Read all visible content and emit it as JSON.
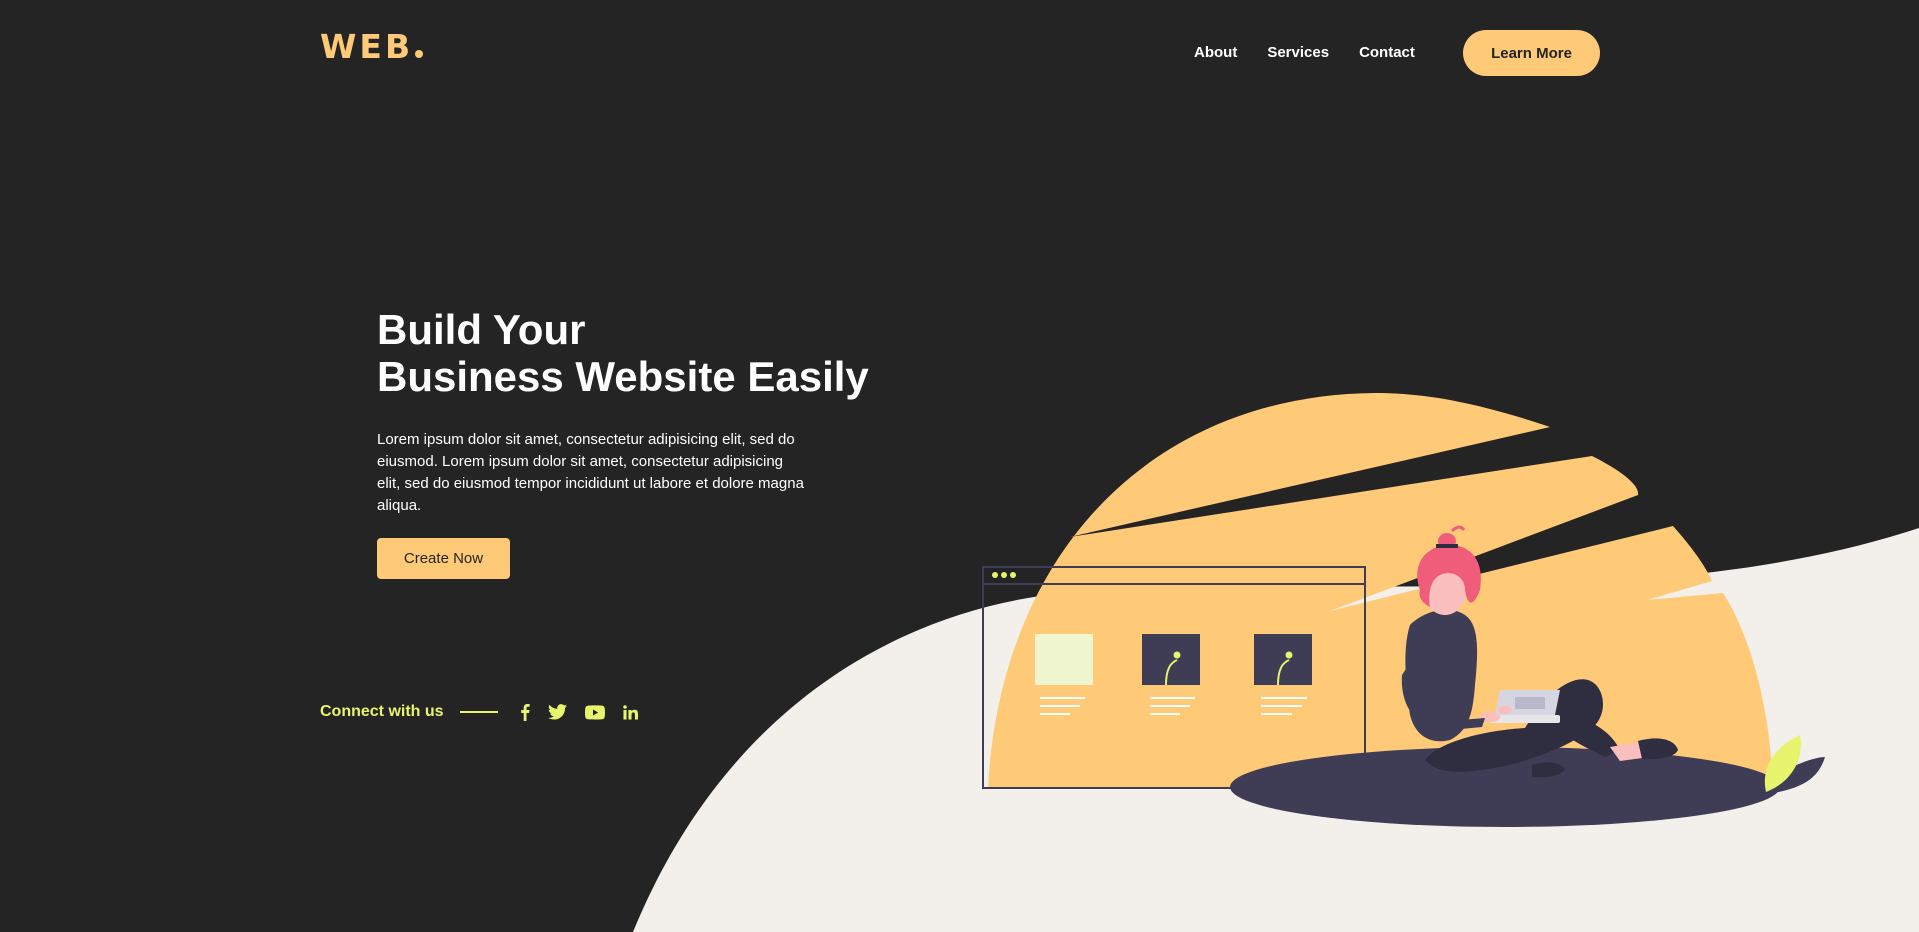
{
  "brand": {
    "logo_text": "WEB"
  },
  "nav": {
    "items": [
      {
        "label": "About"
      },
      {
        "label": "Services"
      },
      {
        "label": "Contact"
      }
    ],
    "cta_label": "Learn More"
  },
  "hero": {
    "title_line1": "Build Your",
    "title_line2": "Business Website Easily",
    "description": "Lorem ipsum dolor sit amet, consectetur adipisicing elit, sed do eiusmod. Lorem ipsum dolor sit amet, consectetur adipisicing elit, sed do eiusmod tempor incididunt ut labore et dolore magna aliqua.",
    "button_label": "Create Now"
  },
  "connect": {
    "label": "Connect with us",
    "socials": [
      {
        "icon": "facebook-icon"
      },
      {
        "icon": "twitter-icon"
      },
      {
        "icon": "youtube-icon"
      },
      {
        "icon": "linkedin-icon"
      }
    ]
  },
  "colors": {
    "background": "#242424",
    "accent": "#ffca78",
    "lime": "#e6f56d",
    "light_bg": "#f3f0eb",
    "figure_dark": "#3f3d56",
    "hair_pink": "#f05d7a"
  }
}
